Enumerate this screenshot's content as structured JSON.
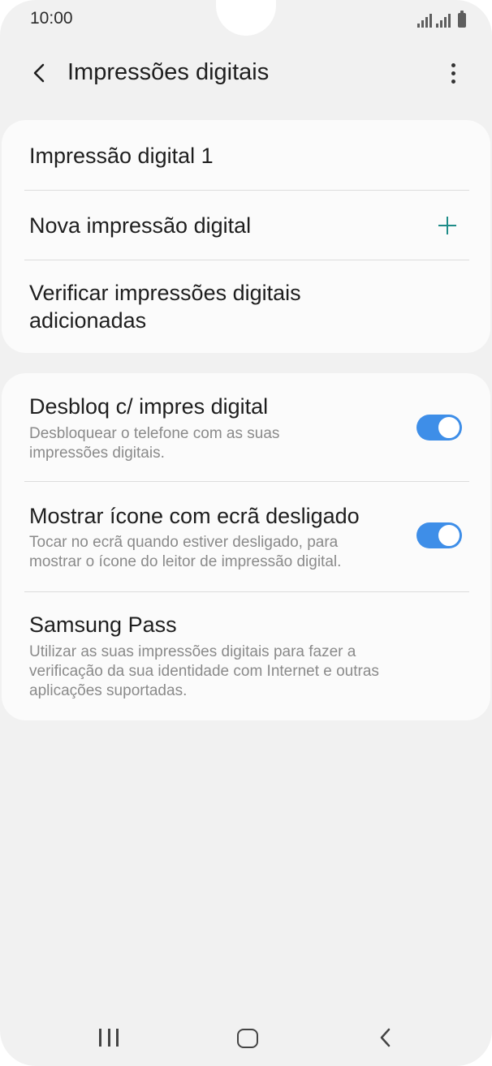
{
  "status_bar": {
    "time": "10:00"
  },
  "header": {
    "title": "Impressões digitais",
    "back_icon": "chevron-left-icon",
    "more_icon": "more-vertical-icon"
  },
  "fingerprints_card": {
    "items": [
      {
        "label": "Impressão digital 1"
      },
      {
        "label": "Nova impressão digital",
        "icon": "plus-icon"
      },
      {
        "label_line1": "Verificar impressões digitais",
        "label_line2": "adicionadas"
      }
    ]
  },
  "settings_card": {
    "items": [
      {
        "title": "Desbloq c/ impres digital",
        "subtitle_line1": "Desbloquear o telefone com as suas",
        "subtitle_line2": "impressões digitais.",
        "toggle_on": true
      },
      {
        "title": "Mostrar ícone com ecrã desligado",
        "subtitle_line1": "Tocar no ecrã quando estiver desligado, para",
        "subtitle_line2": "mostrar o ícone do leitor de impressão digital.",
        "toggle_on": true
      },
      {
        "title": "Samsung Pass",
        "subtitle_line1": "Utilizar as suas impressões digitais para fazer a",
        "subtitle_line2": "verificação da sua identidade com Internet e outras",
        "subtitle_line3": "aplicações suportadas."
      }
    ]
  },
  "colors": {
    "accent_teal": "#1e8c88",
    "toggle_blue": "#3e8ee8",
    "background": "#f1f1f1",
    "card": "#fbfbfb"
  },
  "nav_bar": {
    "recents_icon": "recents-icon",
    "home_icon": "home-icon",
    "back_icon": "back-icon"
  }
}
